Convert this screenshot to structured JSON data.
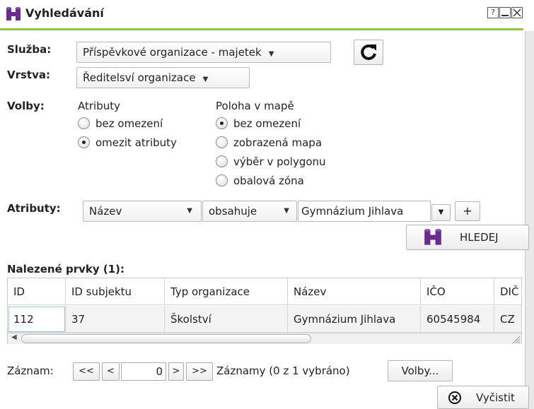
{
  "window": {
    "title": "Vyhledávání",
    "help_label": "?"
  },
  "form": {
    "service_label": "Služba:",
    "service_value": "Příspěvkové organizace - majetek",
    "layer_label": "Vrstva:",
    "layer_value": "Ředitelsví organizace",
    "options_label": "Volby:",
    "attributes_group": {
      "title": "Atributy",
      "options": [
        "bez omezení",
        "omezit atributy"
      ],
      "selected": "omezit atributy"
    },
    "map_group": {
      "title": "Poloha v mapě",
      "options": [
        "bez omezení",
        "zobrazená mapa",
        "výběr v polygonu",
        "obalová zóna"
      ],
      "selected": "bez omezení"
    },
    "attr_row_label": "Atributy:",
    "attr_field": "Název",
    "attr_operator": "obsahuje",
    "attr_value": "Gymnázium Jihlava",
    "add_label": "+",
    "search_label": "HLEDEJ"
  },
  "results": {
    "title": "Nalezené prvky (1):",
    "columns": [
      "ID",
      "ID subjektu",
      "Typ organizace",
      "Název",
      "IČO",
      "DIČ"
    ],
    "rows": [
      [
        "112",
        "37",
        "Školství",
        "Gymnázium Jihlava",
        "60545984",
        "CZ"
      ]
    ]
  },
  "pager": {
    "record_label": "Záznam:",
    "first": "<<",
    "prev": "<",
    "current": "0",
    "next": ">",
    "last": ">>",
    "summary": "Záznamy (0 z 1 vybráno)",
    "options_button": "Volby..."
  },
  "clear_label": "Vyčistit",
  "colors": {
    "accent_green": "#8cc63f",
    "binocular_purple": "#6a2c8e"
  }
}
